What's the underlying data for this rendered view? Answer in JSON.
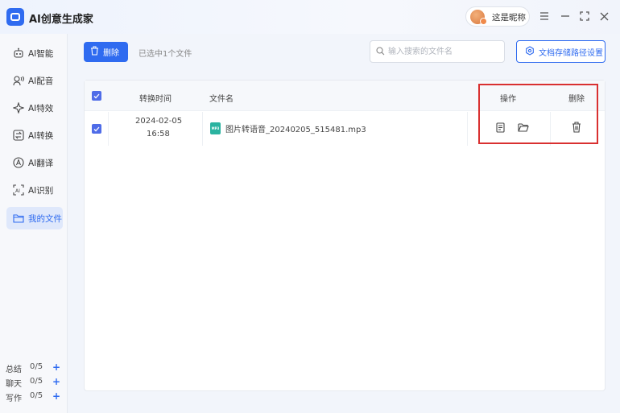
{
  "app": {
    "title": "AI创意生成家",
    "user_name": "这是昵称"
  },
  "window_controls": [
    "menu-icon",
    "minimize-icon",
    "maximize-icon",
    "close-icon"
  ],
  "sidebar": {
    "items": [
      {
        "label": "AI智能",
        "icon": "robot-icon"
      },
      {
        "label": "AI配音",
        "icon": "voice-icon"
      },
      {
        "label": "AI特效",
        "icon": "sparkle-icon"
      },
      {
        "label": "AI转换",
        "icon": "convert-icon"
      },
      {
        "label": "AI翻译",
        "icon": "translate-icon"
      },
      {
        "label": "AI识别",
        "icon": "recognize-icon"
      },
      {
        "label": "我的文件",
        "icon": "folder-icon",
        "active": true
      }
    ],
    "quotas": [
      {
        "label": "总结",
        "value": "0/5"
      },
      {
        "label": "聊天",
        "value": "0/5"
      },
      {
        "label": "写作",
        "value": "0/5"
      }
    ]
  },
  "toolbar": {
    "delete_label": "删除",
    "selected_text": "已选中1个文件",
    "search_placeholder": "输入搜索的文件名",
    "path_setting_label": "文档存储路径设置"
  },
  "table": {
    "headers": {
      "time": "转换时间",
      "filename": "文件名",
      "actions": "操作",
      "delete": "删除"
    },
    "rows": [
      {
        "checked": true,
        "date": "2024-02-05",
        "time": "16:58",
        "filename": "图片转语音_20240205_515481.mp3",
        "file_type": "MP3"
      }
    ]
  },
  "colors": {
    "accent": "#2f6bf0",
    "checkbox": "#4f6ce8",
    "highlight": "#d93030",
    "file_icon": "#2bb3a0"
  }
}
